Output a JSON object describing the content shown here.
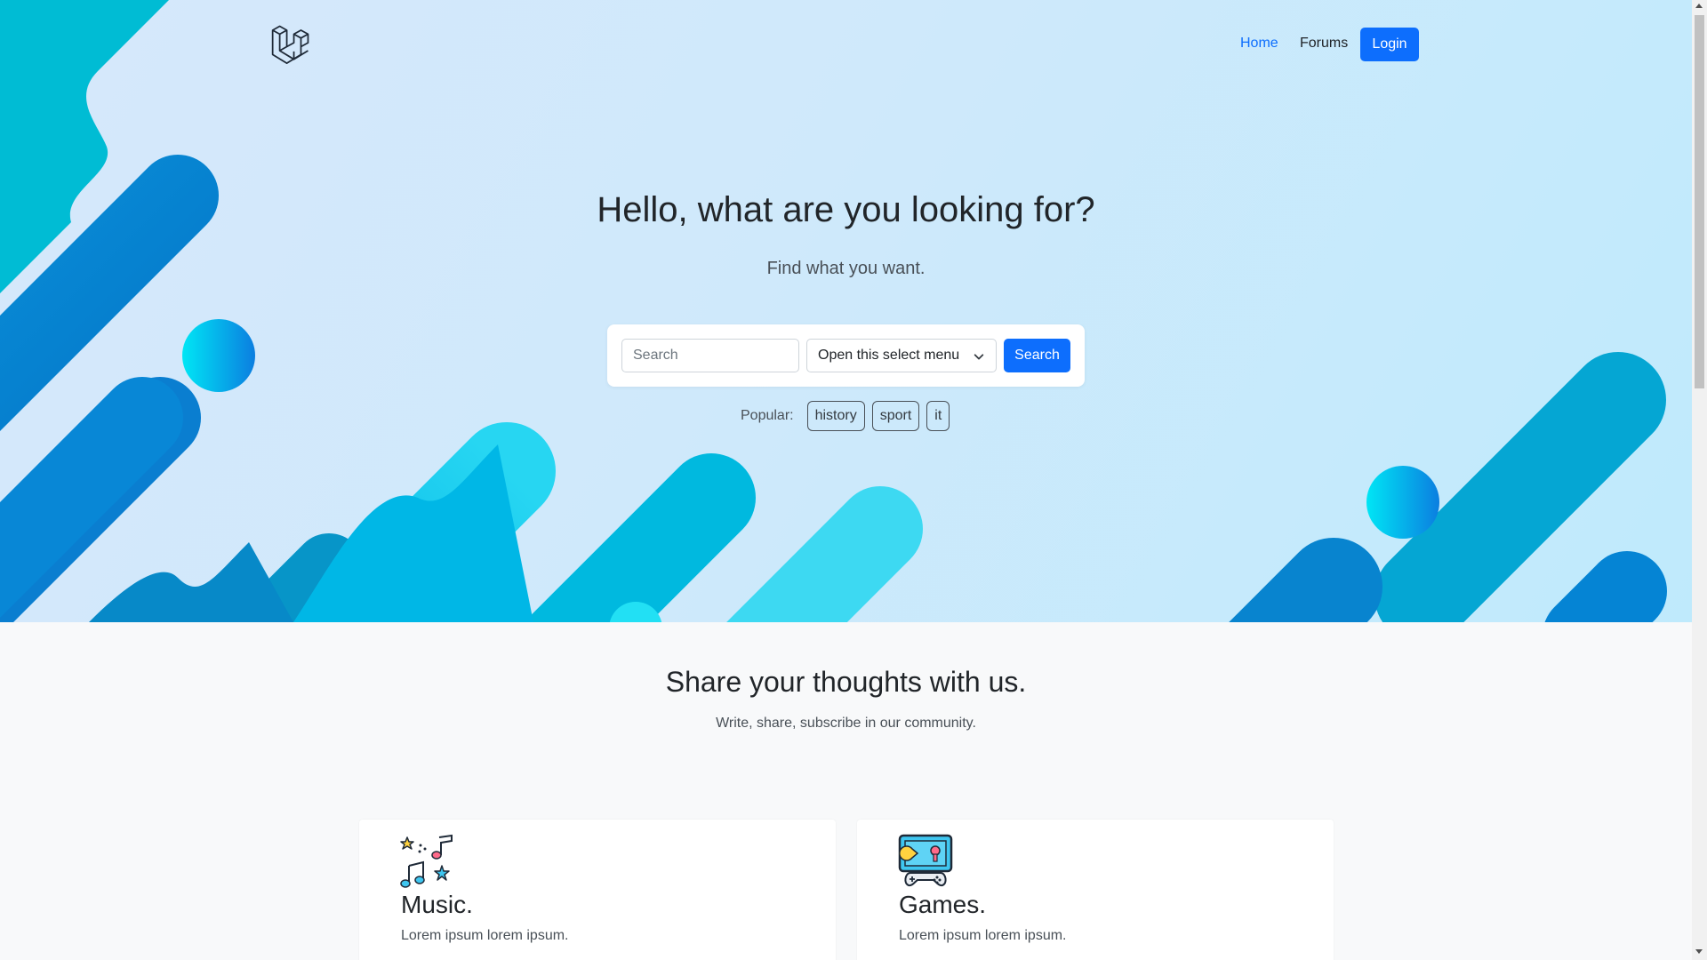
{
  "nav": {
    "logo_icon": "laravel-logo-icon",
    "home_label": "Home",
    "forums_label": "Forums",
    "login_label": "Login"
  },
  "hero": {
    "title": "Hello, what are you looking for?",
    "subtitle": "Find what you want.",
    "search": {
      "placeholder": "Search",
      "value": "",
      "select_value": "Open this select menu",
      "button_label": "Search"
    },
    "popular": {
      "label": "Popular:",
      "tags": [
        "history",
        "sport",
        "it"
      ]
    }
  },
  "section": {
    "title": "Share your thoughts with us.",
    "subtitle": "Write, share, subscribe in our community."
  },
  "cards": [
    {
      "icon": "music-notes-icon",
      "title": "Music.",
      "text": "Lorem ipsum lorem ipsum."
    },
    {
      "icon": "gamepad-icon",
      "title": "Games.",
      "text": "Lorem ipsum lorem ipsum."
    }
  ],
  "colors": {
    "primary": "#0d6efd",
    "hero_bg": "#cfe9fb",
    "shape_blue": "#0284d4",
    "shape_cyan": "#00c8ef",
    "page_bg": "#f8f9fa"
  }
}
